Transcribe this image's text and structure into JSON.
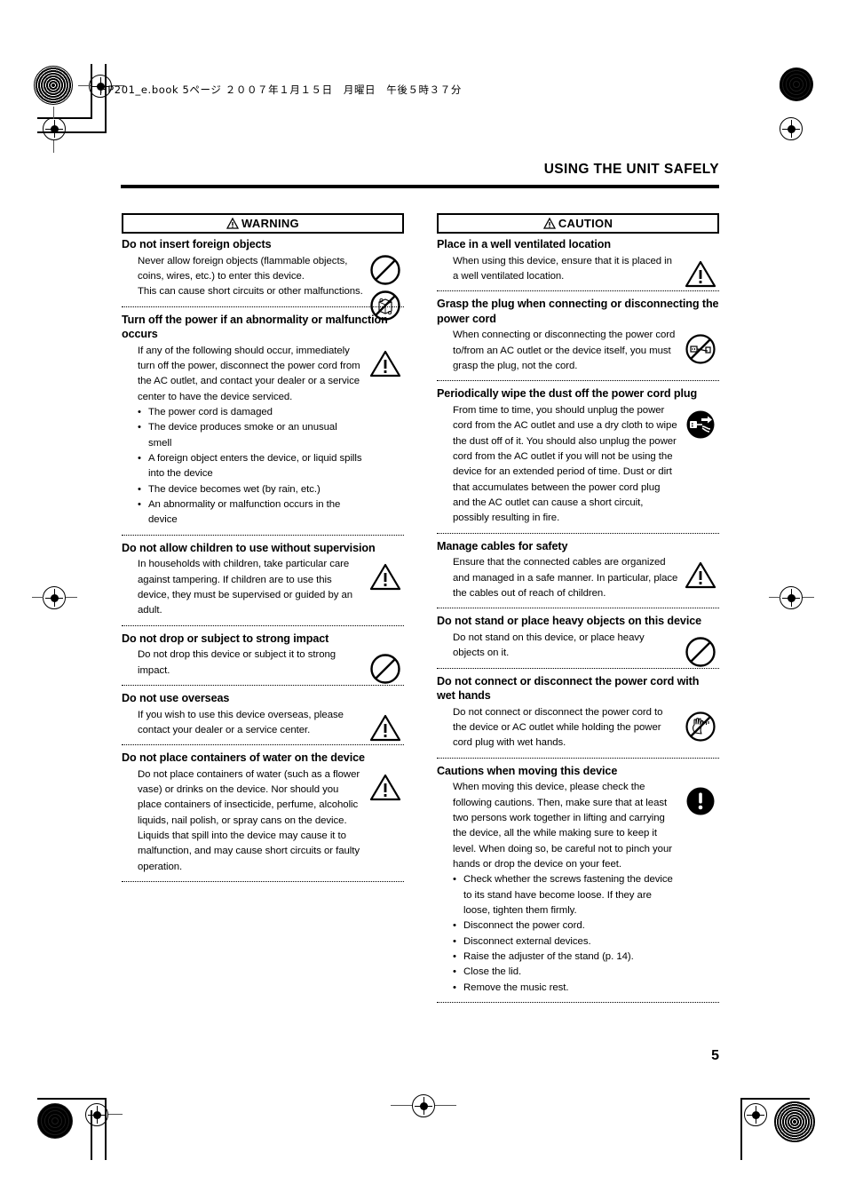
{
  "header": {
    "file_line": "HP201_e.book  5ページ  ２００７年１月１５日　月曜日　午後５時３７分",
    "doc_title": "USING THE UNIT SAFELY",
    "page_number": "5"
  },
  "columns": {
    "warning": {
      "level_label": "WARNING",
      "level_icon": "warning-triangle-icon",
      "sections": [
        {
          "title": "Do not insert foreign objects",
          "paragraphs": [
            "Never allow foreign objects (flammable objects, coins, wires, etc.) to enter this device.",
            "This can cause short circuits or other malfunctions."
          ],
          "bullets": [],
          "icons": [
            "prohibition-icon",
            "no-foreign-objects-icon"
          ]
        },
        {
          "title": "Turn off the power if an abnormality or malfunction occurs",
          "paragraphs": [
            "If any of the following should occur, immediately turn off the power, disconnect the power cord from the AC outlet, and contact your dealer or a service center to have the device serviced."
          ],
          "bullets": [
            "The power cord is damaged",
            "The device produces smoke or an unusual smell",
            "A foreign object enters the device, or liquid spills into the device",
            "The device becomes wet (by rain, etc.)",
            "An abnormality or malfunction occurs in the device"
          ],
          "icons": [
            "caution-triangle-icon"
          ]
        },
        {
          "title": "Do not allow children to use without supervision",
          "paragraphs": [
            "In households with children, take particular care against tampering. If children are to use this device, they must be supervised or guided by an adult."
          ],
          "bullets": [],
          "icons": [
            "caution-triangle-icon"
          ]
        },
        {
          "title": "Do not drop or subject to strong impact",
          "paragraphs": [
            "Do not drop this device or subject it to strong impact."
          ],
          "bullets": [],
          "icons": [
            "prohibition-icon"
          ]
        },
        {
          "title": "Do not use overseas",
          "paragraphs": [
            "If you wish to use this device overseas, please contact your dealer or a service center."
          ],
          "bullets": [],
          "icons": [
            "caution-triangle-icon"
          ]
        },
        {
          "title": "Do not place containers of water on the device",
          "paragraphs": [
            "Do not place containers of water (such as a flower vase) or drinks on the device. Nor should you place containers of insecticide, perfume, alcoholic liquids, nail polish, or spray cans on the device. Liquids that spill into the device may cause it to malfunction, and may cause short circuits or faulty operation."
          ],
          "bullets": [],
          "icons": [
            "caution-triangle-icon"
          ]
        }
      ]
    },
    "caution": {
      "level_label": "CAUTION",
      "level_icon": "warning-triangle-icon",
      "sections": [
        {
          "title": "Place in a well ventilated location",
          "paragraphs": [
            "When using this device, ensure that it is placed in a well ventilated location."
          ],
          "bullets": [],
          "icons": [
            "caution-triangle-icon"
          ]
        },
        {
          "title": "Grasp the plug when connecting or disconnecting the power cord",
          "paragraphs": [
            "When connecting or disconnecting the power cord to/from an AC outlet or the device itself, you must grasp the plug, not the cord."
          ],
          "bullets": [],
          "icons": [
            "no-pull-cord-icon"
          ]
        },
        {
          "title": "Periodically wipe the dust off the power cord plug",
          "paragraphs": [
            "From time to time, you should unplug the power cord from the AC outlet and use a dry cloth to wipe the dust off of it. You should also unplug the power cord from the AC outlet if you will not be using the device for an extended period of time. Dust or dirt that accumulates between the power cord plug and the AC outlet can cause a short circuit, possibly resulting in fire."
          ],
          "bullets": [],
          "icons": [
            "unplug-cord-icon"
          ]
        },
        {
          "title": "Manage cables for safety",
          "paragraphs": [
            "Ensure that the connected cables are organized and managed in a safe manner. In particular, place the cables out of reach of children."
          ],
          "bullets": [],
          "icons": [
            "caution-triangle-icon"
          ]
        },
        {
          "title": "Do not stand or place heavy objects on this device",
          "paragraphs": [
            "Do not stand on this device, or place heavy objects on it."
          ],
          "bullets": [],
          "icons": [
            "prohibition-icon"
          ]
        },
        {
          "title": "Do not connect or disconnect the power cord with wet hands",
          "paragraphs": [
            "Do not connect or disconnect the power cord to the device or AC outlet while holding the power cord plug with wet hands."
          ],
          "bullets": [],
          "icons": [
            "no-wet-hands-icon"
          ]
        },
        {
          "title": "Cautions when moving this device",
          "paragraphs": [
            "When moving this device, please check the following cautions. Then, make sure that at least two persons work together in lifting and carrying the device, all the while making sure to keep it level. When doing so, be careful not to pinch your hands or drop the device on your feet."
          ],
          "bullets": [
            "Check whether the screws fastening the device to its stand have become loose. If they are loose, tighten them firmly.",
            "Disconnect the power cord.",
            "Disconnect external devices.",
            "Raise the adjuster of the stand (p. 14).",
            "Close the lid.",
            "Remove the music rest."
          ],
          "icons": [
            "mandatory-exclamation-icon"
          ]
        }
      ]
    }
  }
}
